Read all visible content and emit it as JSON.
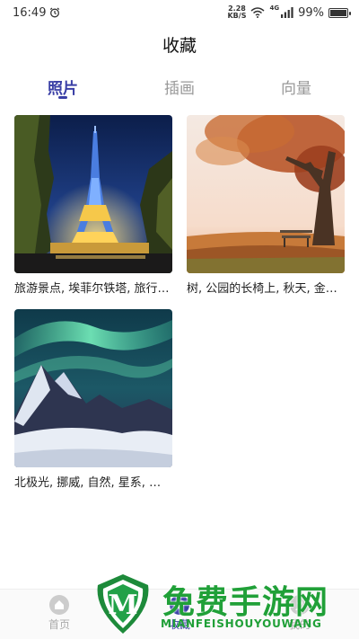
{
  "status_bar": {
    "time": "16:49",
    "speed_value": "2.28",
    "speed_unit": "KB/S",
    "network": "4G",
    "battery": "99%",
    "battery_level": 0.99
  },
  "header": {
    "title": "收藏"
  },
  "tabs": [
    {
      "label": "照片",
      "active": true
    },
    {
      "label": "插画",
      "active": false
    },
    {
      "label": "向量",
      "active": false
    }
  ],
  "photos": [
    {
      "caption": "旅游景点, 埃菲尔铁塔, 旅行…"
    },
    {
      "caption": "树, 公园的长椅上, 秋天, 金…"
    },
    {
      "caption": "北极光, 挪威, 自然, 星系, 罗…"
    }
  ],
  "bottom_nav": [
    {
      "label": "首页",
      "icon": "home-icon",
      "active": false
    },
    {
      "label": "收藏",
      "icon": "favorites-icon",
      "active": true
    },
    {
      "label": "我的",
      "icon": "profile-icon",
      "active": false
    }
  ],
  "watermark": {
    "text": "免费手游网",
    "sub": "MIANFEISHOUYOUWANG",
    "logo_letter": "M"
  },
  "colors": {
    "accent": "#3a3fa6",
    "watermark": "#20a038"
  }
}
